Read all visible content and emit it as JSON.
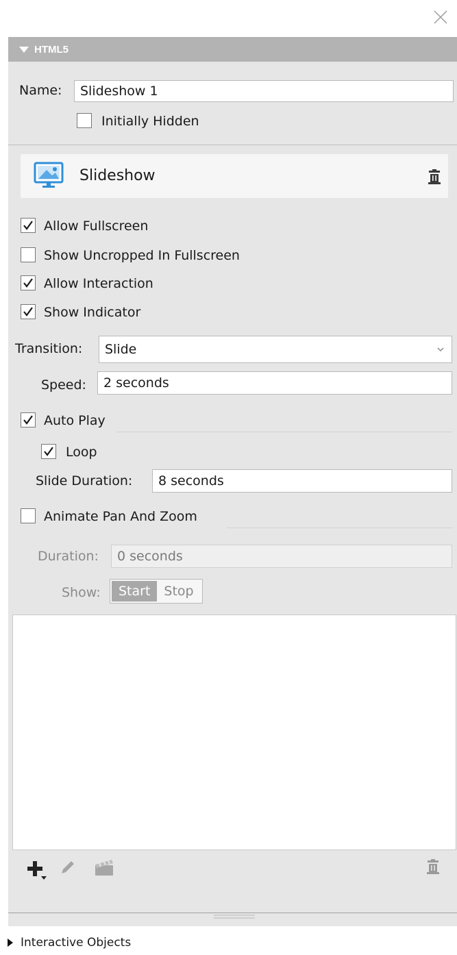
{
  "window": {
    "close_icon": "close-icon"
  },
  "section": {
    "title": "HTML5",
    "expanded": true
  },
  "name_row": {
    "label": "Name:",
    "value": "Slideshow 1"
  },
  "initially_hidden": {
    "label": "Initially Hidden",
    "checked": false
  },
  "object_header": {
    "title": "Slideshow",
    "icon": "slideshow-image-icon",
    "delete_icon": "trash-icon"
  },
  "options": [
    {
      "label": "Allow Fullscreen",
      "checked": true
    },
    {
      "label": "Show Uncropped In Fullscreen",
      "checked": false
    },
    {
      "label": "Allow Interaction",
      "checked": true
    },
    {
      "label": "Show Indicator",
      "checked": true
    }
  ],
  "transition": {
    "label": "Transition:",
    "value": "Slide"
  },
  "speed": {
    "label": "Speed:",
    "value": "2 seconds"
  },
  "auto_play": {
    "label": "Auto Play",
    "checked": true
  },
  "loop": {
    "label": "Loop",
    "checked": true
  },
  "slide_duration": {
    "label": "Slide Duration:",
    "value": "8 seconds"
  },
  "animate_pan_zoom": {
    "label": "Animate Pan And Zoom",
    "checked": false
  },
  "pan_duration": {
    "label": "Duration:",
    "value": "0 seconds"
  },
  "show_toggle": {
    "label": "Show:",
    "options": [
      "Start",
      "Stop"
    ],
    "selected": "Start"
  },
  "toolbar": {
    "icons": [
      "add-icon",
      "edit-pencil-icon",
      "clapperboard-icon",
      "trash-icon"
    ]
  },
  "footer": {
    "label": "Interactive Objects"
  },
  "colors": {
    "header_bg": "#b3b3b3",
    "panel_bg": "#e6e6e6",
    "accent_blue": "#2f8fd8"
  }
}
